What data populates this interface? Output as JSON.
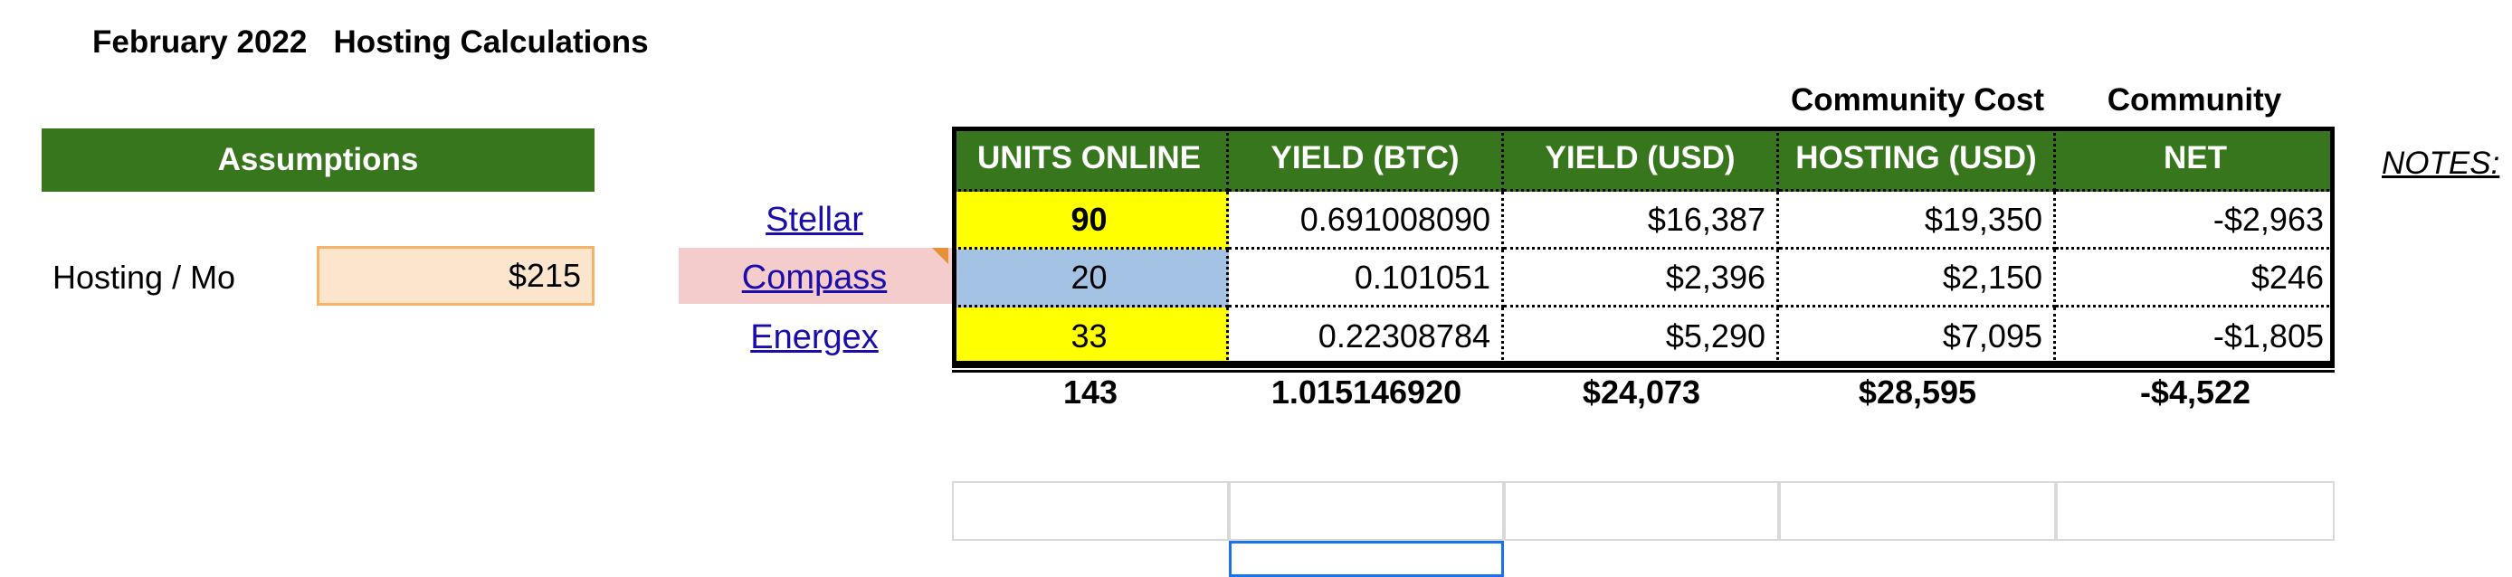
{
  "title": "February 2022   Hosting Calculations",
  "assumptions": {
    "header": "Assumptions",
    "hosting_label": "Hosting / Mo",
    "hosting_value": "$215"
  },
  "column_captions": {
    "hosting": "Community Cost",
    "net": "Community"
  },
  "headers": [
    "UNITS ONLINE",
    "YIELD (BTC)",
    "YIELD (USD)",
    "HOSTING (USD)",
    "NET"
  ],
  "rows": [
    {
      "site": "Stellar",
      "units": "90",
      "btc": "0.691008090",
      "usd": "$16,387",
      "hosting": "$19,350",
      "net": "-$2,963"
    },
    {
      "site": "Compass",
      "units": "20",
      "btc": "0.101051",
      "usd": "$2,396",
      "hosting": "$2,150",
      "net": "$246"
    },
    {
      "site": "Energex",
      "units": "33",
      "btc": "0.22308784",
      "usd": "$5,290",
      "hosting": "$7,095",
      "net": "-$1,805"
    }
  ],
  "totals": {
    "units": "143",
    "btc": "1.015146920",
    "usd": "$24,073",
    "hosting": "$28,595",
    "net": "-$4,522"
  },
  "notes_label": "NOTES:",
  "colors": {
    "header_green": "#38761d",
    "highlight_yellow": "#ffff00",
    "highlight_blue": "#a4c2e4",
    "input_peach": "#fce5cd",
    "input_border": "#f6b26b",
    "compass_pink": "#f4cccc",
    "link_blue": "#1a0dab",
    "selection_blue": "#1a73e8"
  }
}
